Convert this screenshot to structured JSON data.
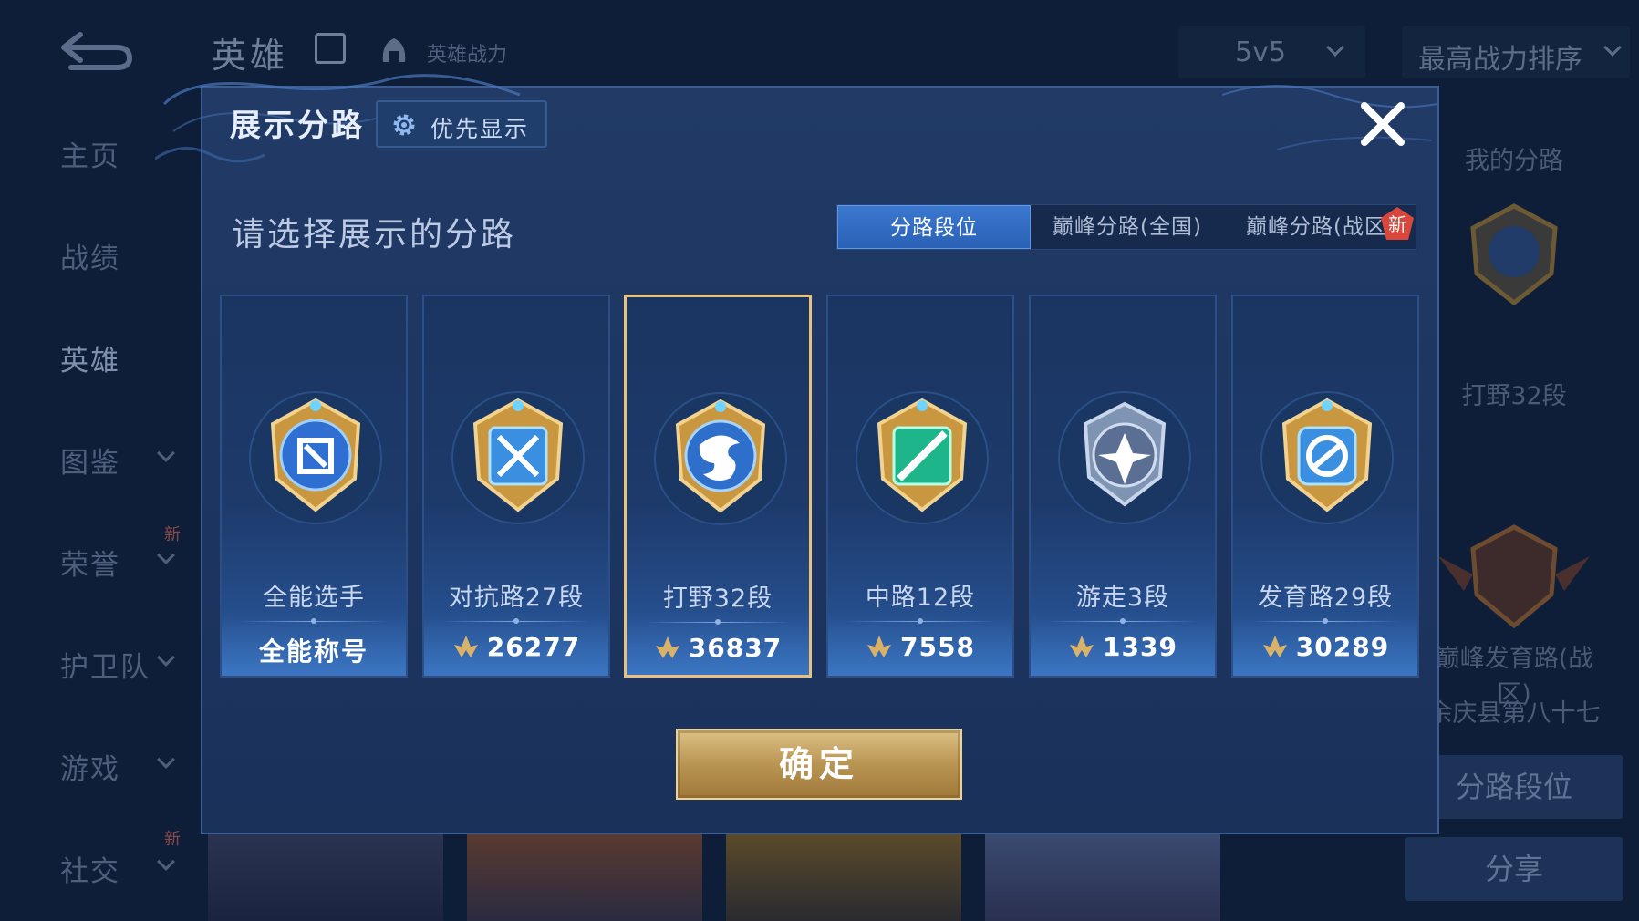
{
  "background": {
    "title": "英雄",
    "power_label": "英雄战力",
    "mode_select": "5v5",
    "sort_select": "最高战力排序",
    "sidebar": [
      {
        "label": "主页",
        "chevron": false
      },
      {
        "label": "战绩",
        "chevron": false
      },
      {
        "label": "英雄",
        "chevron": false,
        "active": true
      },
      {
        "label": "图鉴",
        "chevron": true
      },
      {
        "label": "荣誉",
        "chevron": true,
        "new": true
      },
      {
        "label": "护卫队",
        "chevron": true
      },
      {
        "label": "游戏",
        "chevron": true
      },
      {
        "label": "社交",
        "chevron": true,
        "new": true
      }
    ],
    "new_badge": "新",
    "right_panel": {
      "heading": "我的分路",
      "lane_rank": "打野32段",
      "peak_title": "巅峰发育路(战区)",
      "peak_region": "余庆县第八十七",
      "lane_button": "分路段位",
      "share_button": "分享"
    }
  },
  "dialog": {
    "title": "展示分路",
    "priority_button": "优先显示",
    "subtitle": "请选择展示的分路",
    "tabs": [
      {
        "label": "分路段位",
        "active": true
      },
      {
        "label": "巅峰分路(全国)",
        "active": false
      },
      {
        "label": "巅峰分路(战区)",
        "active": false,
        "new": true
      }
    ],
    "tab_new_badge": "新",
    "cards": [
      {
        "name": "全能选手",
        "value": "全能称号",
        "is_title": true,
        "icon": "all-round-badge-icon",
        "color": "#3a7fd8",
        "selected": false
      },
      {
        "name": "对抗路27段",
        "value": "26277",
        "is_title": false,
        "icon": "clash-lane-badge-icon",
        "color": "#3a8fe0",
        "selected": false
      },
      {
        "name": "打野32段",
        "value": "36837",
        "is_title": false,
        "icon": "jungle-badge-icon",
        "color": "#2f6fcc",
        "selected": true
      },
      {
        "name": "中路12段",
        "value": "7558",
        "is_title": false,
        "icon": "mid-lane-badge-icon",
        "color": "#1fb58a",
        "selected": false
      },
      {
        "name": "游走3段",
        "value": "1339",
        "is_title": false,
        "icon": "roam-badge-icon",
        "color": "#7f93b3",
        "selected": false
      },
      {
        "name": "发育路29段",
        "value": "30289",
        "is_title": false,
        "icon": "farm-lane-badge-icon",
        "color": "#3a8fe0",
        "selected": false
      }
    ],
    "confirm_button": "确定"
  },
  "colors": {
    "gold": "#d9b26a",
    "selected_border": "#e8c27c",
    "tab_active": "#2f6bc0"
  }
}
